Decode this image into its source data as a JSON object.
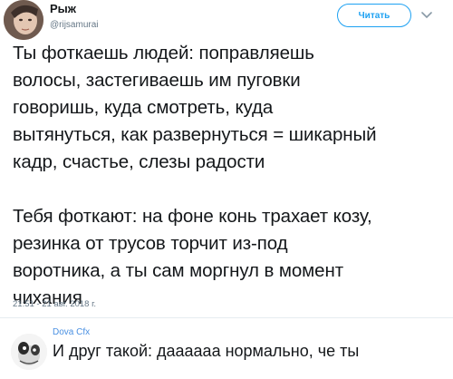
{
  "tweet": {
    "author_name": "Рыж",
    "author_handle": "@rijsamurai",
    "follow_label": "Читать",
    "lines": [
      "Ты фоткаешь людей: поправляешь",
      "волосы, застегиваешь им пуговки",
      "говоришь, куда смотреть, куда",
      "вытянуться, как развернуться = шикарный",
      "кадр, счастье, слезы радости",
      "",
      "Тебя фоткают: на фоне конь трахает козу,",
      "резинка от трусов торчит из-под",
      "воротника, а ты сам моргнул в момент",
      "чихания"
    ],
    "timestamp": "21:51 - 21 авг. 2018 г."
  },
  "reply": {
    "author_name": "Dova Cfx",
    "text": "И друг такой: даааааа нормально, че ты"
  },
  "colors": {
    "accent": "#1da1f2",
    "reply_name": "#4a90e2",
    "muted": "#657786",
    "text": "#14171a"
  },
  "icons": {
    "follow_chevron": "chevron-down-icon"
  }
}
